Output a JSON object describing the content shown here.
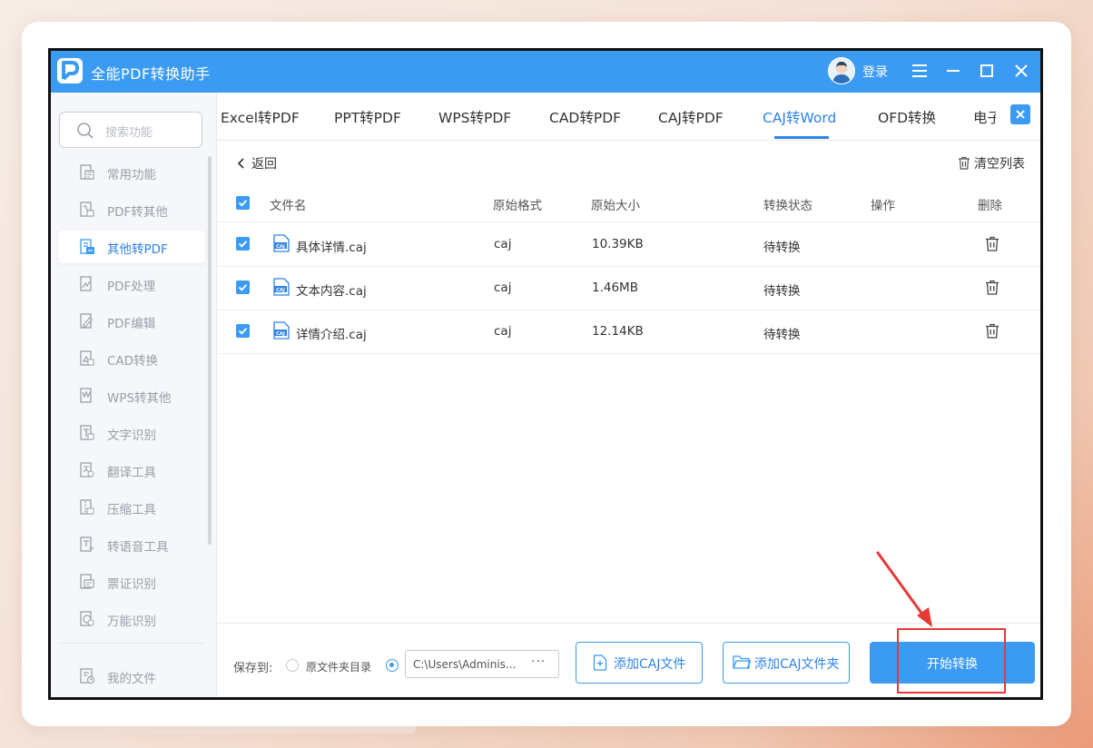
{
  "app": {
    "title": "全能PDF转换助手",
    "login_label": "登录"
  },
  "search": {
    "placeholder": "搜索功能"
  },
  "sidebar": {
    "items": [
      {
        "label": "常用功能",
        "icon": "common-functions-icon",
        "active": false
      },
      {
        "label": "PDF转其他",
        "icon": "pdf-to-other-icon",
        "active": false
      },
      {
        "label": "其他转PDF",
        "icon": "other-to-pdf-icon",
        "active": true
      },
      {
        "label": "PDF处理",
        "icon": "pdf-process-icon",
        "active": false
      },
      {
        "label": "PDF编辑",
        "icon": "pdf-edit-icon",
        "active": false
      },
      {
        "label": "CAD转换",
        "icon": "cad-convert-icon",
        "active": false
      },
      {
        "label": "WPS转其他",
        "icon": "wps-convert-icon",
        "active": false
      },
      {
        "label": "文字识别",
        "icon": "ocr-icon",
        "active": false
      },
      {
        "label": "翻译工具",
        "icon": "translate-icon",
        "active": false
      },
      {
        "label": "压缩工具",
        "icon": "compress-icon",
        "active": false
      },
      {
        "label": "转语音工具",
        "icon": "text-to-speech-icon",
        "active": false
      },
      {
        "label": "票证识别",
        "icon": "ticket-recognition-icon",
        "active": false
      },
      {
        "label": "万能识别",
        "icon": "universal-recognition-icon",
        "active": false
      }
    ],
    "my_files": "我的文件"
  },
  "tabs": [
    {
      "label": "Excel转PDF",
      "active": false
    },
    {
      "label": "PPT转PDF",
      "active": false
    },
    {
      "label": "WPS转PDF",
      "active": false
    },
    {
      "label": "CAD转PDF",
      "active": false
    },
    {
      "label": "CAJ转PDF",
      "active": false
    },
    {
      "label": "CAJ转Word",
      "active": true
    },
    {
      "label": "OFD转换",
      "active": false
    },
    {
      "label": "电子",
      "active": false
    }
  ],
  "toolbar": {
    "back_label": "返回",
    "clear_label": "清空列表"
  },
  "table": {
    "headers": {
      "name": "文件名",
      "format": "原始格式",
      "size": "原始大小",
      "status": "转换状态",
      "action": "操作",
      "delete": "删除"
    },
    "rows": [
      {
        "name": "具体详情.caj",
        "format": "caj",
        "size": "10.39KB",
        "status": "待转换",
        "checked": true
      },
      {
        "name": "文本内容.caj",
        "format": "caj",
        "size": "1.46MB",
        "status": "待转换",
        "checked": true
      },
      {
        "name": "详情介绍.caj",
        "format": "caj",
        "size": "12.14KB",
        "status": "待转换",
        "checked": true
      }
    ],
    "file_icon_text": "CAJ"
  },
  "bottom": {
    "save_to_label": "保存到:",
    "option_source_label": "原文件夹目录",
    "path_value": "C:\\Users\\Adminis...",
    "path_more": "···",
    "add_file_label": "添加CAJ文件",
    "add_folder_label": "添加CAJ文件夹",
    "start_label": "开始转换"
  },
  "colors": {
    "accent": "#3b9bf2",
    "active_text": "#2f83e8",
    "highlight": "#e53935"
  }
}
